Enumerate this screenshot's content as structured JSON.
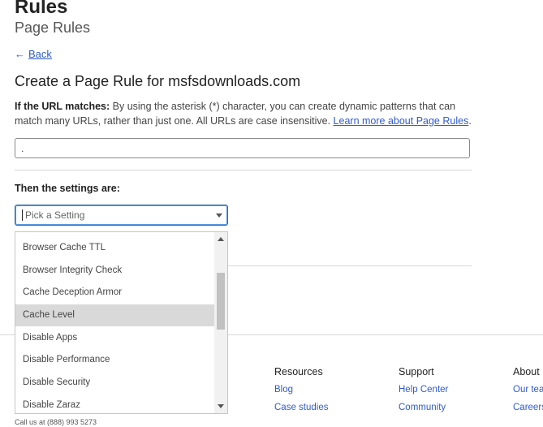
{
  "header": {
    "title": "Rules",
    "subtitle": "Page Rules",
    "back_label": "Back"
  },
  "form": {
    "heading": "Create a Page Rule for msfsdownloads.com",
    "url_match_label": "If the URL matches:",
    "url_match_desc": "By using the asterisk (*) character, you can create dynamic patterns that can match many URLs, rather than just one. All URLs are case insensitive.",
    "learn_more": "Learn more about Page Rules",
    "url_value": ".",
    "settings_label": "Then the settings are:",
    "setting_placeholder": "Pick a Setting"
  },
  "dropdown": {
    "options": [
      {
        "label": "Browser Cache TTL",
        "selected": false
      },
      {
        "label": "Browser Integrity Check",
        "selected": false
      },
      {
        "label": "Cache Deception Armor",
        "selected": false
      },
      {
        "label": "Cache Level",
        "selected": true
      },
      {
        "label": "Disable Apps",
        "selected": false
      },
      {
        "label": "Disable Performance",
        "selected": false
      },
      {
        "label": "Disable Security",
        "selected": false
      },
      {
        "label": "Disable Zaraz",
        "selected": false
      }
    ]
  },
  "footer": {
    "resources": {
      "title": "Resources",
      "links": [
        "Blog",
        "Case studies"
      ]
    },
    "support": {
      "title": "Support",
      "links": [
        "Help Center",
        "Community"
      ]
    },
    "about": {
      "title": "About",
      "links": [
        "Our team",
        "Careers"
      ]
    },
    "contact_fragment": "Call us at (888) 993 5273"
  },
  "colors": {
    "link": "#2f5bd0",
    "focus_border": "#2b6cb0",
    "selected_option": "#d9d9d9"
  }
}
